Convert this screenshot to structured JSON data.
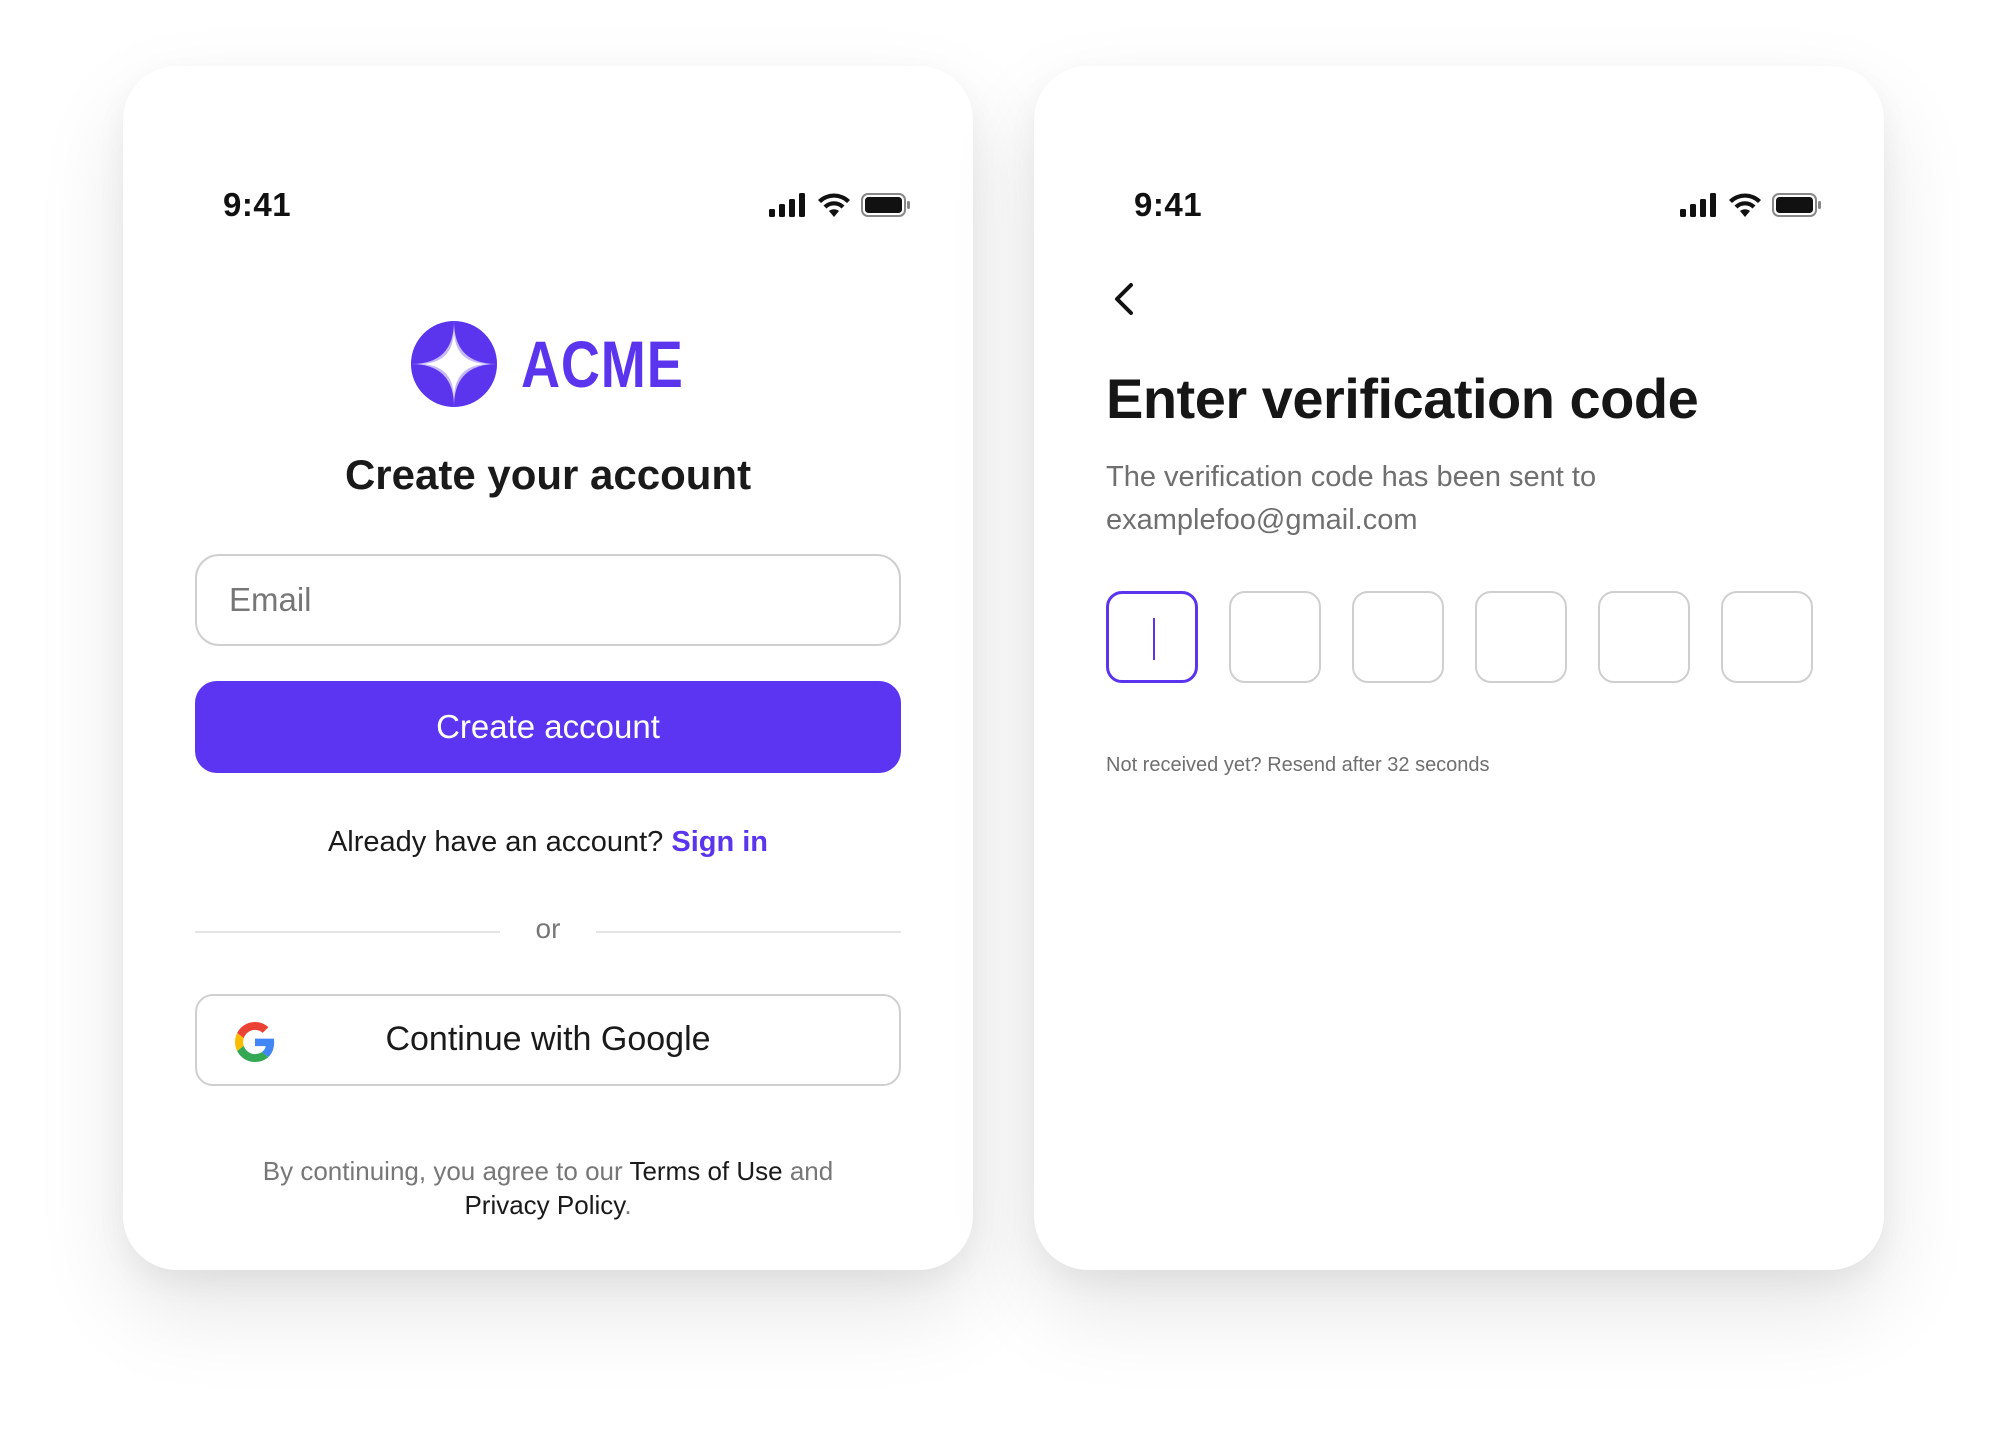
{
  "signup_screen": {
    "status_bar": {
      "time": "9:41"
    },
    "logo": {
      "wordmark": "ACME"
    },
    "title": "Create your account",
    "email_field": {
      "placeholder": "Email",
      "value": ""
    },
    "create_button_label": "Create account",
    "signin_prompt": "Already have an account?",
    "signin_link": "Sign in",
    "divider_text": "or",
    "google_button_label": "Continue with Google",
    "legal": {
      "prefix": "By continuing, you agree to our",
      "terms_link": "Terms of Use",
      "joiner": "and",
      "privacy_link": "Privacy Policy",
      "suffix": "."
    }
  },
  "verify_screen": {
    "status_bar": {
      "time": "9:41"
    },
    "title": "Enter verification code",
    "subtitle_line1": "The verification code has been sent to",
    "subtitle_email": "examplefoo@gmail.com",
    "code_length": 6,
    "active_box_index": 0,
    "resend_text": "Not received yet? Resend after 32 seconds"
  },
  "colors": {
    "brand": "#5b35ee",
    "brand_light": "#c5b7fb",
    "text_primary": "#1a1a1a",
    "text_muted": "#777777",
    "border": "#cfcfcf"
  },
  "icons": [
    "cellular-signal-icon",
    "wifi-icon",
    "battery-icon",
    "acme-star-logo-icon",
    "google-g-icon",
    "chevron-left-icon"
  ]
}
